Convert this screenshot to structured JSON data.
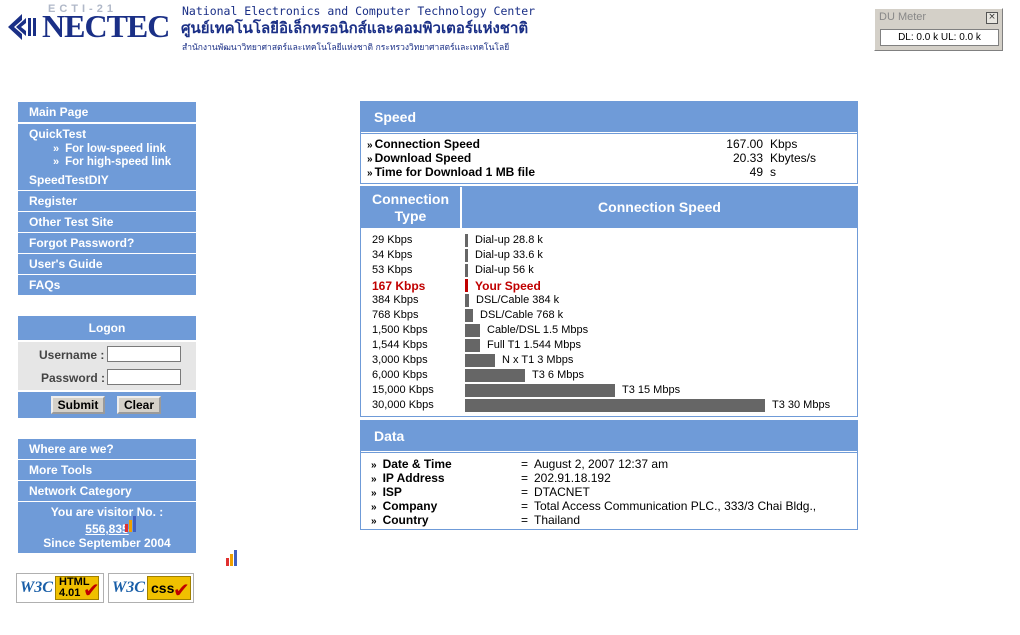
{
  "header": {
    "logo_top": "ECTI-21",
    "logo_word": "NECTEC",
    "title_en": "National Electronics and Computer Technology Center",
    "title_th": "ศูนย์เทคโนโลยีอิเล็กทรอนิกส์และคอมพิวเตอร์แห่งชาติ",
    "subtitle_th": "สำนักงานพัฒนาวิทยาศาสตร์และเทคโนโลยีแห่งชาติ กระทรวงวิทยาศาสตร์และเทคโนโลยี"
  },
  "du_meter": {
    "title": "DU Meter",
    "close": "×",
    "value": "DL: 0.0 k  UL: 0.0 k"
  },
  "sidebar": {
    "main_page": "Main Page",
    "quicktest": "QuickTest",
    "quicktest_low": "For low-speed link",
    "quicktest_high": "For high-speed link",
    "speedtestdiy": "SpeedTestDIY",
    "register": "Register",
    "other_test_site": "Other Test Site",
    "forgot_password": "Forgot Password?",
    "users_guide": "User's Guide",
    "faqs": "FAQs",
    "where_are_we": "Where are we?",
    "more_tools": "More Tools",
    "network_category": "Network Category",
    "visitor_line1": "You are visitor No. :",
    "visitor_count": "556,835",
    "visitor_line3": "Since September 2004"
  },
  "logon": {
    "title": "Logon",
    "username_label": "Username :",
    "password_label": "Password :",
    "submit": "Submit",
    "clear": "Clear"
  },
  "speed": {
    "title": "Speed",
    "rows": [
      {
        "label": "Connection Speed",
        "value": "167.00",
        "unit": "Kbps"
      },
      {
        "label": "Download Speed",
        "value": "20.33",
        "unit": "Kbytes/s"
      },
      {
        "label": "Time for Download 1 MB file",
        "value": "49",
        "unit": "s"
      }
    ]
  },
  "connection_table": {
    "col1_line1": "Connection",
    "col1_line2": "Type",
    "col2": "Connection Speed",
    "rows": [
      {
        "speed": "29 Kbps",
        "label": "Dial-up   28.8 k",
        "kbps": 29
      },
      {
        "speed": "34 Kbps",
        "label": "Dial-up   33.6 k",
        "kbps": 34
      },
      {
        "speed": "53 Kbps",
        "label": "Dial-up   56 k",
        "kbps": 53
      },
      {
        "speed": "167 Kbps",
        "label": "Your Speed",
        "kbps": 167,
        "highlight": true
      },
      {
        "speed": "384 Kbps",
        "label": "DSL/Cable   384 k",
        "kbps": 384
      },
      {
        "speed": "768 Kbps",
        "label": "DSL/Cable   768 k",
        "kbps": 768
      },
      {
        "speed": "1,500 Kbps",
        "label": "Cable/DSL   1.5 Mbps",
        "kbps": 1500
      },
      {
        "speed": "1,544 Kbps",
        "label": "Full T1   1.544 Mbps",
        "kbps": 1544
      },
      {
        "speed": "3,000 Kbps",
        "label": "N x T1   3 Mbps",
        "kbps": 3000
      },
      {
        "speed": "6,000 Kbps",
        "label": "T3   6 Mbps",
        "kbps": 6000
      },
      {
        "speed": "15,000 Kbps",
        "label": "T3   15 Mbps",
        "kbps": 15000
      },
      {
        "speed": "30,000 Kbps",
        "label": "T3   30 Mbps",
        "kbps": 30000
      }
    ]
  },
  "data_panel": {
    "title": "Data",
    "rows": [
      {
        "label": "Date & Time",
        "value": "August 2, 2007  12:37 am"
      },
      {
        "label": "IP Address",
        "value": "202.91.18.192"
      },
      {
        "label": "ISP",
        "value": "DTACNET"
      },
      {
        "label": "Company",
        "value": "Total Access Communication PLC., 333/3 Chai Bldg.,"
      },
      {
        "label": "Country",
        "value": "Thailand"
      }
    ]
  },
  "badges": {
    "html_w3c": "W3C",
    "html_badge": "HTML 4.01",
    "css_w3c": "W3C",
    "css_badge": "css",
    "check": "✔"
  },
  "colors": {
    "accent": "#6f9bd8",
    "brand": "#1a2f86",
    "highlight": "#c00000",
    "bar": "#666666"
  }
}
